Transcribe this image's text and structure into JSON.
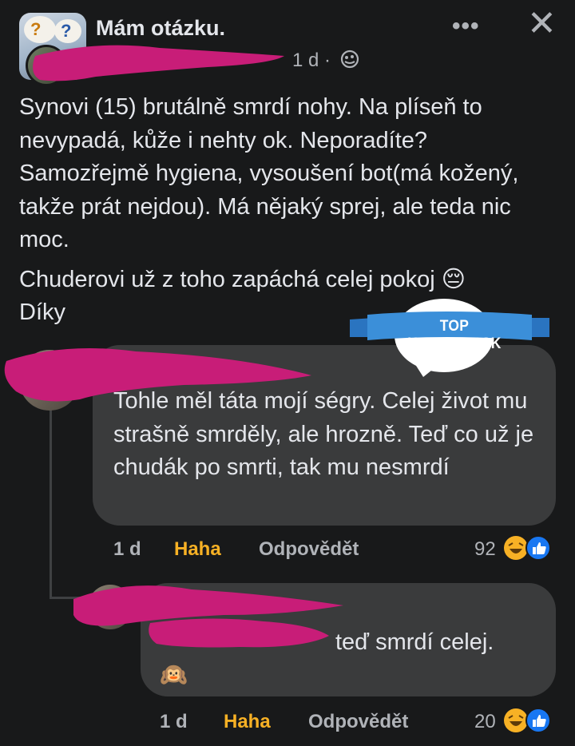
{
  "header": {
    "group_name": "Mám otázku.",
    "more_icon": "•••",
    "close_icon": "✕",
    "meta_time": "1 d ·",
    "privacy_icon": "globe-icon"
  },
  "post": {
    "paragraph1": "Synovi (15) brutálně smrdí nohy. Na plíseň to nevypadá, kůže i nehty ok. Neporadíte? Samozřejmě hygiena, vysoušení bot(má kožený, takže prát nejdou). Má nějaký sprej, ale teda nic moc.",
    "paragraph2_line1": "Chuderovi už z toho zapáchá celej pokoj 😔",
    "paragraph2_line2": "Díky"
  },
  "watermark": {
    "text": "TOP KOMENTY.SK",
    "color": "#3b8fd9"
  },
  "comments": [
    {
      "text": "Tohle měl táta mojí ségry. Celej život mu strašně smrděly, ale hrozně. Teď co už je chudák po smrti, tak mu nesmrdí",
      "time": "1 d",
      "reaction_label": "Haha",
      "reply_label": "Odpovědět",
      "reaction_count": "92"
    },
    {
      "text": "teď smrdí celej.",
      "emoji": "🙉",
      "time": "1 d",
      "reaction_label": "Haha",
      "reply_label": "Odpovědět",
      "reaction_count": "20"
    }
  ],
  "colors": {
    "background": "#18191a",
    "bubble": "#3a3b3c",
    "secondary_text": "#b0b3b8",
    "haha": "#f7b125",
    "redaction": "#c81d78"
  }
}
